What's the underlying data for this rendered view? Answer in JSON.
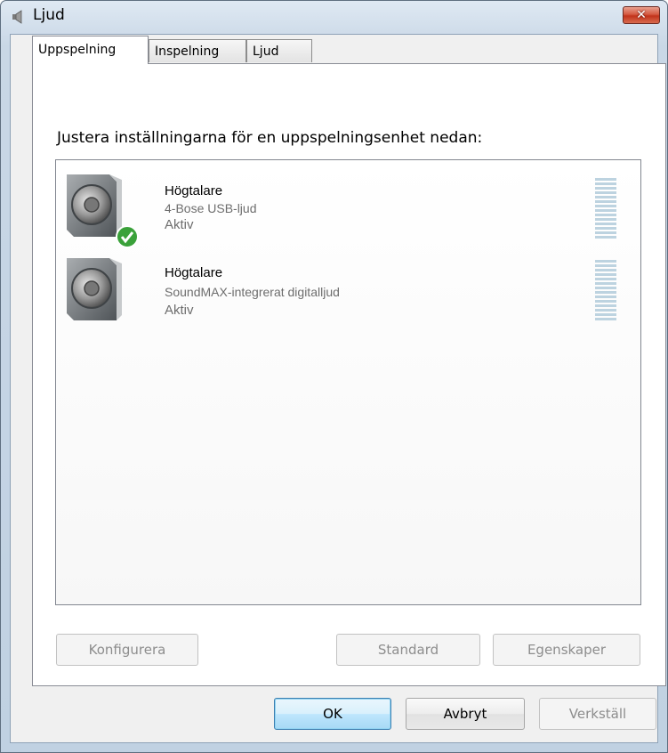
{
  "window": {
    "title": "Ljud",
    "close_label": "✕"
  },
  "tabs": [
    {
      "label": "Uppspelning",
      "active": true
    },
    {
      "label": "Inspelning",
      "active": false
    },
    {
      "label": "Ljud",
      "active": false
    }
  ],
  "instruction": "Justera inställningarna för en uppspelningsenhet nedan:",
  "devices": [
    {
      "name": "Högtalare",
      "description": "4-Bose USB-ljud",
      "status": "Aktiv",
      "is_default": true,
      "icon": "speaker-icon"
    },
    {
      "name": "Högtalare",
      "description": "SoundMAX-integrerat digitalljud",
      "status": "Aktiv",
      "is_default": false,
      "icon": "speaker-icon"
    }
  ],
  "panel_buttons": {
    "configure": "Konfigurera",
    "set_default": "Standard",
    "properties": "Egenskaper"
  },
  "dialog_buttons": {
    "ok": "OK",
    "cancel": "Avbryt",
    "apply": "Verkställ"
  },
  "colors": {
    "accent": "#3c7fb1",
    "close": "#c2331b",
    "check": "#3aa13a"
  }
}
